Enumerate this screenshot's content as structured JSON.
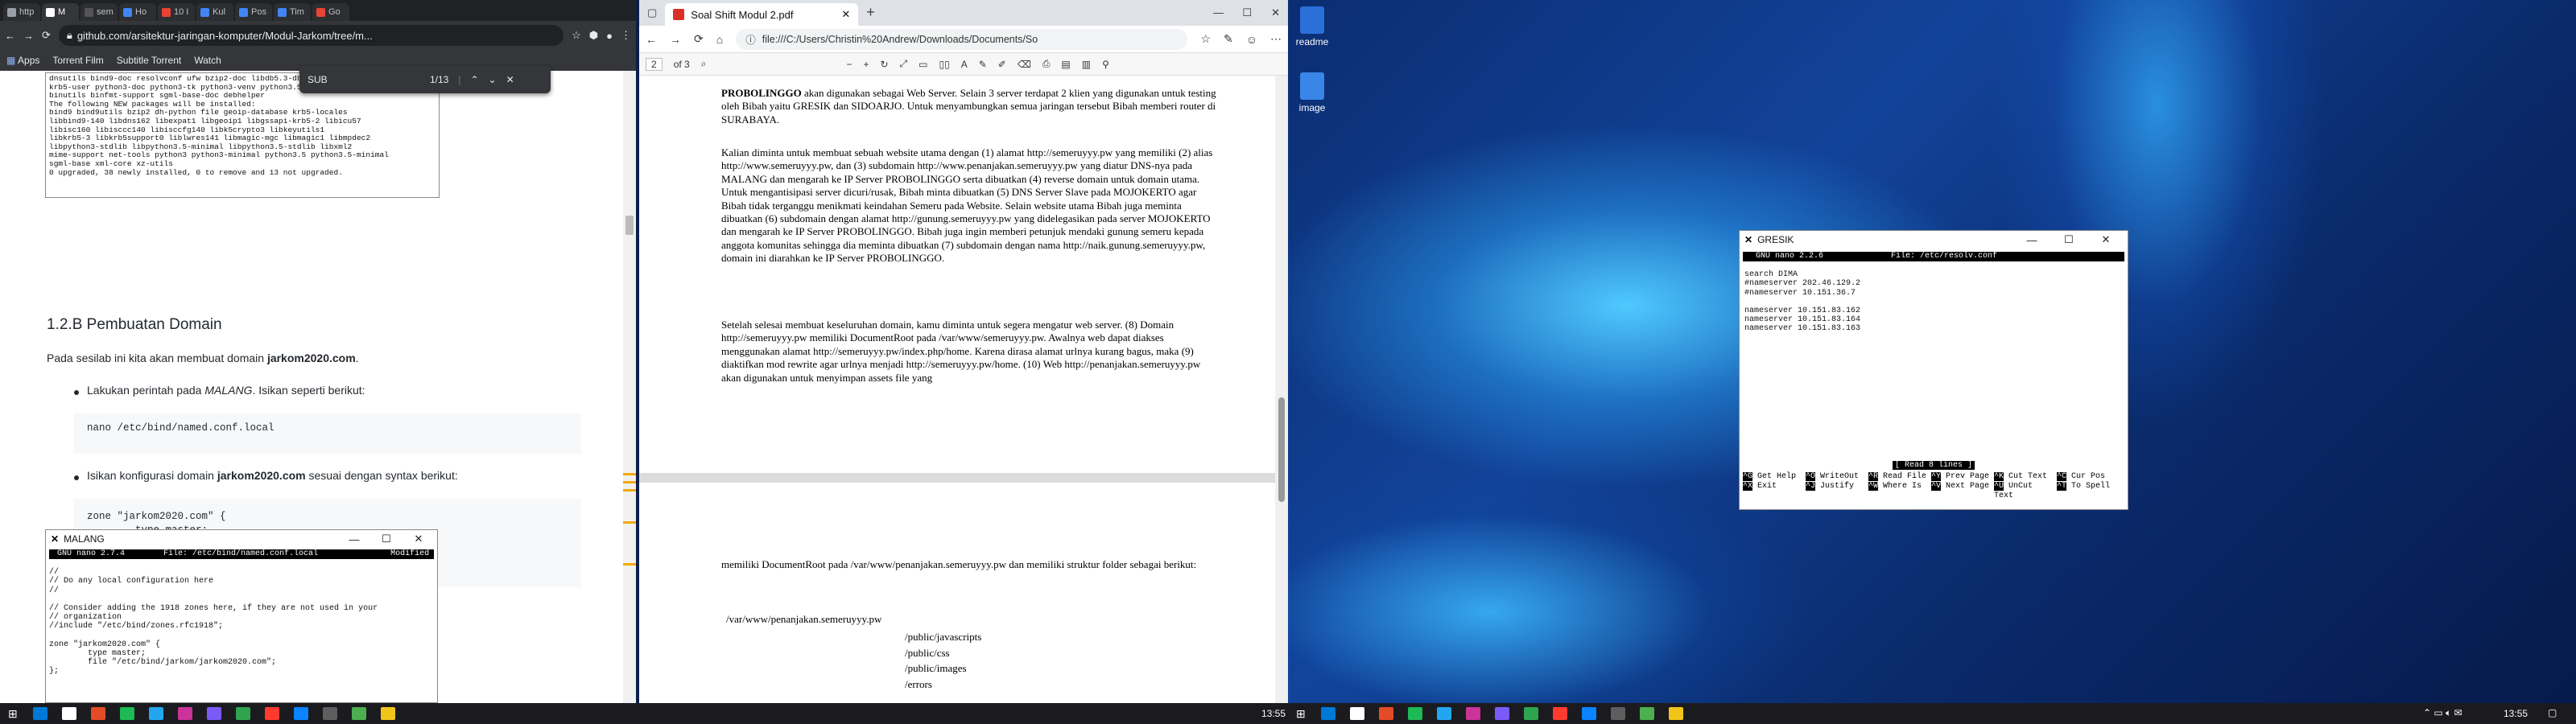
{
  "chrome": {
    "tabs": [
      {
        "label": "http",
        "color": "#9aa0a6"
      },
      {
        "label": "M",
        "color": "#ffffff"
      },
      {
        "label": "sem",
        "color": "#555555"
      },
      {
        "label": "Ho",
        "color": "#4285f4"
      },
      {
        "label": "10 I",
        "color": "#ea4335"
      },
      {
        "label": "Kul",
        "color": "#4285f4"
      },
      {
        "label": "Pos",
        "color": "#4285f4"
      },
      {
        "label": "Tim",
        "color": "#4285f4"
      },
      {
        "label": "Go",
        "color": "#ea4335"
      }
    ],
    "url": "github.com/arsitektur-jaringan-komputer/Modul-Jarkom/tree/m...",
    "bookmarks": [
      "Apps",
      "Torrent Film",
      "Subtitle Torrent",
      "Watch"
    ],
    "find": {
      "query": "SUB",
      "count": "1/13"
    },
    "terminal_lines": [
      "dnsutils bind9-doc resolvconf ufw bzip2-doc libdb5.3-dbg-gimp geoip-bin",
      "krb5-user python3-doc python3-tk python3-venv python3.5-venv python3.5-doc",
      "binutils binfmt-support sgml-base-doc debhelper",
      "The following NEW packages will be installed:",
      "bind9 bind9utils bzip2 dh-python file geoip-database krb5-locales",
      "libbind9-140 libdns162 libexpat1 libgeoip1 libgssapi-krb5-2 libicu57",
      "libisc160 libisccc140 libisccfg140 libk5crypto3 libkeyutils1",
      "libkrb5-3 libkrb5support0 liblwres141 libmagic-mgc libmagic1 libmpdec2",
      "libpython3-stdlib libpython3.5-minimal libpython3.5-stdlib libxml2",
      "mime-support net-tools python3 python3-minimal python3.5 python3.5-minimal",
      "sgml-base xml-core xz-utils",
      "0 upgraded, 38 newly installed, 0 to remove and 13 not upgraded."
    ],
    "heading": "1.2.B Pembuatan Domain",
    "intro_prefix": "Pada sesilab ini kita akan membuat domain ",
    "intro_domain": "jarkom2020.com",
    "intro_suffix": ".",
    "step1_prefix": "Lakukan perintah pada ",
    "step1_host": "MALANG",
    "step1_suffix": ". Isikan seperti berikut:",
    "step1_code": "nano /etc/bind/named.conf.local",
    "step2_prefix": "Isikan konfigurasi domain ",
    "step2_domain": "jarkom2020.com",
    "step2_suffix": " sesuai dengan syntax berikut:",
    "step2_code": "zone \"jarkom2020.com\" {\n        type master;\n        file \"/etc/bind/jarkom/jarkom2020.com\";\n};",
    "malang": {
      "title": "MALANG",
      "bar": " GNU nano 2.7.4        File: /etc/bind/named.conf.local               Modified",
      "body": "\n//\n// Do any local configuration here\n//\n\n// Consider adding the 1918 zones here, if they are not used in your\n// organization\n//include \"/etc/bind/zones.rfc1918\";\n\nzone \"jarkom2020.com\" {\n        type master;\n        file \"/etc/bind/jarkom/jarkom2020.com\";\n};"
    }
  },
  "edge": {
    "tab_title": "Soal Shift Modul 2.pdf",
    "address": "file:///C:/Users/Christin%20Andrew/Downloads/Documents/So",
    "page_num": "2",
    "page_total": "of 3",
    "para1_bold_lead": "PROBOLINGGO",
    "para1": " akan digunakan sebagai Web Server. Selain 3 server terdapat 2 klien yang digunakan untuk testing oleh Bibah yaitu GRESIK dan SIDOARJO. Untuk menyambungkan semua jaringan tersebut Bibah memberi router di SURABAYA.",
    "para2": "Kalian diminta untuk membuat sebuah website utama dengan (1) alamat http://semeruyyy.pw yang memiliki (2) alias http://www.semeruyyy.pw, dan (3) subdomain http://www.penanjakan.semeruyyy.pw yang diatur DNS-nya pada MALANG dan mengarah ke IP Server PROBOLINGGO serta dibuatkan (4) reverse domain untuk domain utama. Untuk mengantisipasi server dicuri/rusak, Bibah minta dibuatkan (5) DNS Server Slave pada MOJOKERTO agar Bibah tidak terganggu menikmati keindahan Semeru pada Website. Selain website utama Bibah juga meminta dibuatkan (6) subdomain dengan alamat http://gunung.semeruyyy.pw yang didelegasikan pada server MOJOKERTO dan mengarah ke IP Server PROBOLINGGO. Bibah juga ingin memberi petunjuk mendaki gunung semeru kepada anggota komunitas sehingga dia meminta dibuatkan (7) subdomain dengan nama http://naik.gunung.semeruyyy.pw, domain ini diarahkan ke IP Server PROBOLINGGO.",
    "para3": "Setelah selesai membuat keseluruhan domain, kamu diminta untuk segera mengatur web server. (8) Domain http://semeruyyy.pw memiliki DocumentRoot pada /var/www/semeruyyy.pw. Awalnya web dapat diakses menggunakan alamat http://semeruyyy.pw/index.php/home. Karena dirasa alamat urlnya kurang bagus, maka (9) diaktifkan mod rewrite agar urlnya menjadi http://semeruyyy.pw/home. (10) Web http://penanjakan.semeruyyy.pw akan digunakan untuk menyimpan assets file yang",
    "page3_line": "memiliki DocumentRoot pada /var/www/penanjakan.semeruyyy.pw dan memiliki struktur folder sebagai berikut:",
    "tree_root": "/var/www/penanjakan.semeruyyy.pw",
    "tree_items": [
      "/public/javascripts",
      "/public/css",
      "/public/images",
      "/errors"
    ]
  },
  "gresik": {
    "title": "GRESIK",
    "bar": "  GNU nano 2.2.6              File: /etc/resolv.conf",
    "body": "\nsearch DIMA\n#nameserver 202.46.129.2\n#nameserver 10.151.36.7\n\nnameserver 10.151.83.162\nnameserver 10.151.83.164\nnameserver 10.151.83.163",
    "status": "[ Read 8 lines ]",
    "shortcuts1": [
      [
        "^G",
        "Get Help"
      ],
      [
        "^O",
        "WriteOut"
      ],
      [
        "^R",
        "Read File"
      ],
      [
        "^Y",
        "Prev Page"
      ],
      [
        "^K",
        "Cut Text"
      ],
      [
        "^C",
        "Cur Pos"
      ]
    ],
    "shortcuts2": [
      [
        "^X",
        "Exit"
      ],
      [
        "^J",
        "Justify"
      ],
      [
        "^W",
        "Where Is"
      ],
      [
        "^V",
        "Next Page"
      ],
      [
        "^U",
        "UnCut Text"
      ],
      [
        "^T",
        "To Spell"
      ]
    ]
  },
  "desktop": {
    "icons": [
      {
        "label": "readme",
        "color": "#2b6fd8"
      },
      {
        "label": "image",
        "color": "#3a86e8"
      }
    ]
  },
  "taskbar": {
    "time_left": "13:55",
    "time_right": "13:55",
    "icons_left": [
      "#0078d7",
      "#ffffff",
      "#e34c26",
      "#1db954",
      "#23a6f0",
      "#cc3399",
      "#7a5af8",
      "#2ea44f",
      "#ff3b30",
      "#0a84ff",
      "#5e5e5e",
      "#4caf50",
      "#f0c419"
    ],
    "icons_right": [
      "#0078d7",
      "#ffffff",
      "#e34c26",
      "#1db954",
      "#23a6f0",
      "#cc3399",
      "#7a5af8",
      "#2ea44f",
      "#ff3b30",
      "#0a84ff",
      "#5e5e5e",
      "#4caf50",
      "#f0c419"
    ]
  }
}
